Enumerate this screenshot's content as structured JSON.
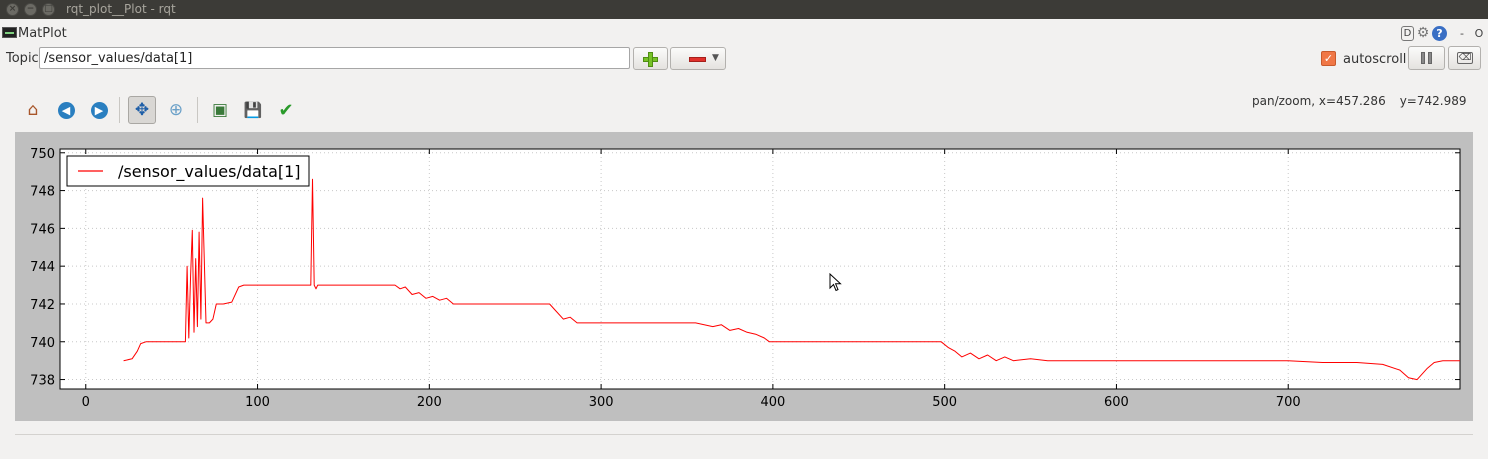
{
  "window": {
    "title": "rqt_plot__Plot - rqt",
    "close_glyph": "×",
    "min_glyph": "−",
    "max_glyph": "□"
  },
  "plugin": {
    "title": "MatPlot",
    "d_label": "D",
    "gear_glyph": "⚙",
    "help_label": "?",
    "min_label": "-",
    "close_label": "O"
  },
  "topic": {
    "label": "Topic",
    "value": "/sensor_values/data[1]"
  },
  "controls": {
    "remove_caret": "▼",
    "autoscroll_label": "autoscroll",
    "autoscroll_checked": true,
    "check_glyph": "✓",
    "clear_glyph": "⌫"
  },
  "toolbar": {
    "home_glyph": "⌂",
    "back_glyph": "◀",
    "forward_glyph": "▶",
    "pan_glyph": "✥",
    "zoom_glyph": "⊕",
    "subplots_glyph": "▣",
    "save_glyph": "💾",
    "apply_glyph": "✔",
    "active_tool": "pan"
  },
  "status": {
    "mode_x": "pan/zoom, x=457.286",
    "y": "y=742.989"
  },
  "colors": {
    "series": "#ff0000",
    "plot_frame": "#bfbfbf",
    "grid": "#c8c8c8"
  },
  "chart_data": {
    "type": "line",
    "title": "",
    "xlabel": "",
    "ylabel": "",
    "xlim": [
      -15,
      800
    ],
    "ylim": [
      737.5,
      750.2
    ],
    "xticks": [
      0,
      100,
      200,
      300,
      400,
      500,
      600,
      700
    ],
    "yticks": [
      738,
      740,
      742,
      744,
      746,
      748,
      750
    ],
    "grid": true,
    "legend_position": "top-left",
    "series": [
      {
        "name": "/sensor_values/data[1]",
        "color": "#ff0000",
        "x": [
          22,
          27,
          30,
          32,
          35,
          45,
          58,
          59,
          60,
          61,
          62,
          63,
          64,
          65,
          66,
          67,
          68,
          70,
          72,
          74,
          76,
          80,
          85,
          89,
          92,
          100,
          110,
          120,
          130,
          131,
          132,
          133,
          134,
          135,
          150,
          170,
          180,
          183,
          186,
          190,
          194,
          198,
          202,
          206,
          210,
          214,
          220,
          240,
          260,
          270,
          274,
          278,
          282,
          286,
          290,
          300,
          330,
          355,
          360,
          365,
          370,
          375,
          380,
          385,
          390,
          395,
          398,
          420,
          460,
          498,
          502,
          506,
          510,
          515,
          520,
          525,
          530,
          535,
          540,
          550,
          560,
          565,
          600,
          650,
          700,
          720,
          740,
          755,
          765,
          770,
          775,
          778,
          781,
          785,
          790,
          800
        ],
        "y": [
          739.0,
          739.1,
          739.5,
          739.9,
          740.0,
          740.0,
          740.0,
          744.0,
          740.2,
          743.5,
          745.9,
          740.5,
          744.4,
          740.8,
          745.8,
          741.2,
          747.6,
          741.0,
          741.0,
          741.2,
          742.0,
          742.0,
          742.1,
          742.9,
          743.0,
          743.0,
          743.0,
          743.0,
          743.0,
          743.0,
          748.6,
          743.0,
          742.8,
          743.0,
          743.0,
          743.0,
          743.0,
          742.8,
          742.9,
          742.5,
          742.6,
          742.3,
          742.4,
          742.2,
          742.3,
          742.0,
          742.0,
          742.0,
          742.0,
          742.0,
          741.6,
          741.2,
          741.3,
          741.0,
          741.0,
          741.0,
          741.0,
          741.0,
          740.9,
          740.8,
          740.9,
          740.6,
          740.7,
          740.5,
          740.4,
          740.2,
          740.0,
          740.0,
          740.0,
          740.0,
          739.7,
          739.5,
          739.2,
          739.4,
          739.1,
          739.3,
          739.0,
          739.2,
          739.0,
          739.1,
          739.0,
          739.0,
          739.0,
          739.0,
          739.0,
          738.9,
          738.9,
          738.8,
          738.5,
          738.1,
          738.0,
          738.3,
          738.6,
          738.9,
          739.0,
          739.0
        ]
      }
    ]
  }
}
